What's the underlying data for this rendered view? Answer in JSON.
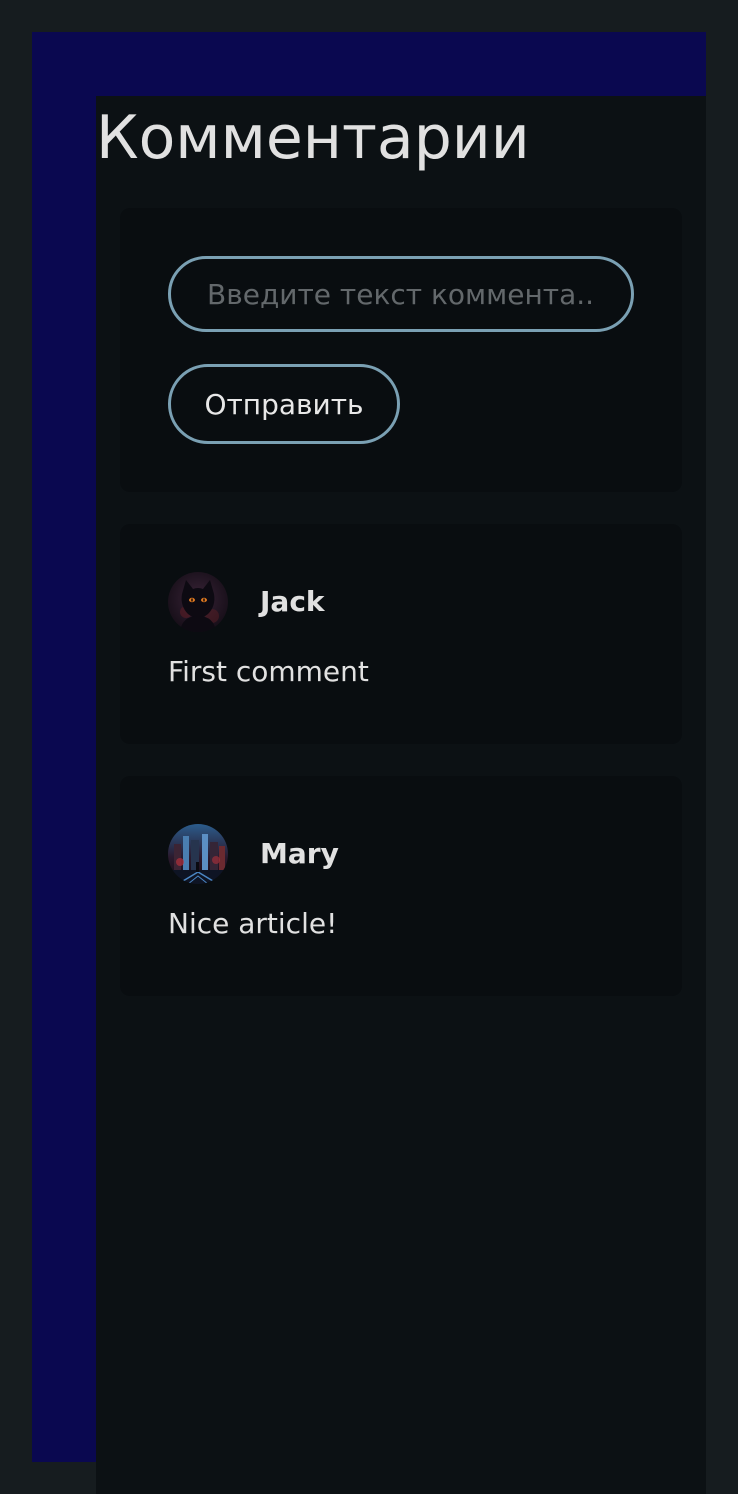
{
  "page": {
    "title": "Комментарии"
  },
  "compose": {
    "placeholder": "Введите текст коммента...",
    "value": "",
    "submit_label": "Отправить"
  },
  "comments": [
    {
      "author": "Jack",
      "text": "First comment",
      "avatar_icon": "black-cat-avatar-icon"
    },
    {
      "author": "Mary",
      "text": "Nice article!",
      "avatar_icon": "night-city-avatar-icon"
    }
  ],
  "colors": {
    "page_bg": "#161c1f",
    "frame": "#0a0850",
    "content_bg": "#0c1114",
    "card_bg": "#090d10",
    "accent_border": "#7aa0b3",
    "text": "#e1e1e1",
    "placeholder": "#63686b"
  }
}
